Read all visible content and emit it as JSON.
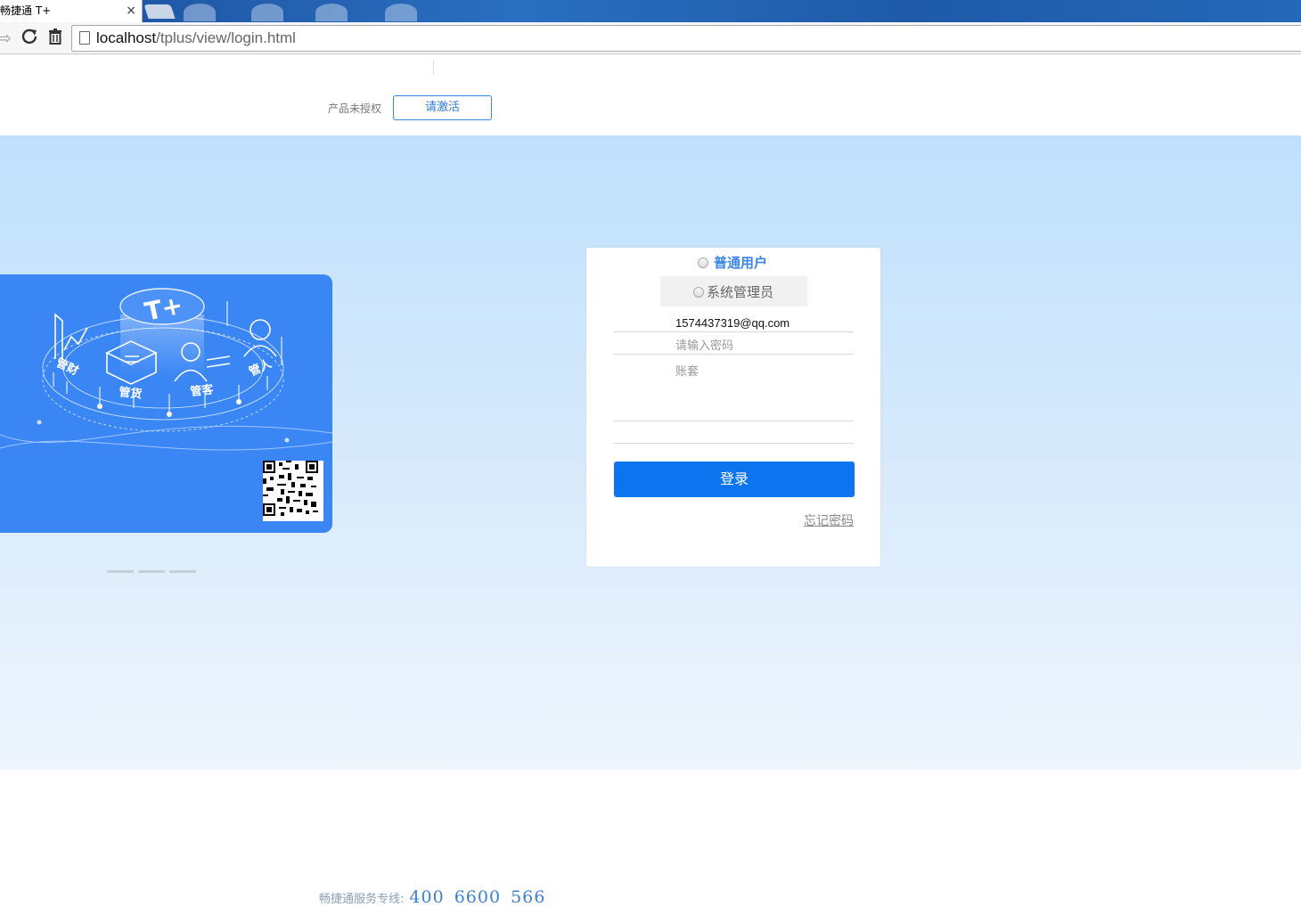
{
  "browser": {
    "tab_title": "畅捷通 T+",
    "tab_close": "×",
    "url_host": "localhost",
    "url_path": "/tplus/view/login.html"
  },
  "header": {
    "unauthorized_text": "产品未授权",
    "activate_label": "请激活"
  },
  "banner": {
    "brand": "T+",
    "labels": [
      "管财",
      "管货",
      "管客",
      "管人"
    ],
    "accent_color": "#3a86f5"
  },
  "login": {
    "roles": [
      {
        "label": "普通用户",
        "selected": false
      },
      {
        "label": "系统管理员",
        "selected": false
      }
    ],
    "account_value": "1574437319@qq.com",
    "password_placeholder": "请输入密码",
    "book_label": "账套",
    "submit_label": "登录",
    "forgot_label": "忘记密码",
    "button_color": "#0d74f0"
  },
  "footer": {
    "hotline_label": "畅捷通服务专线:",
    "hotline_number": "400 6600 566"
  }
}
